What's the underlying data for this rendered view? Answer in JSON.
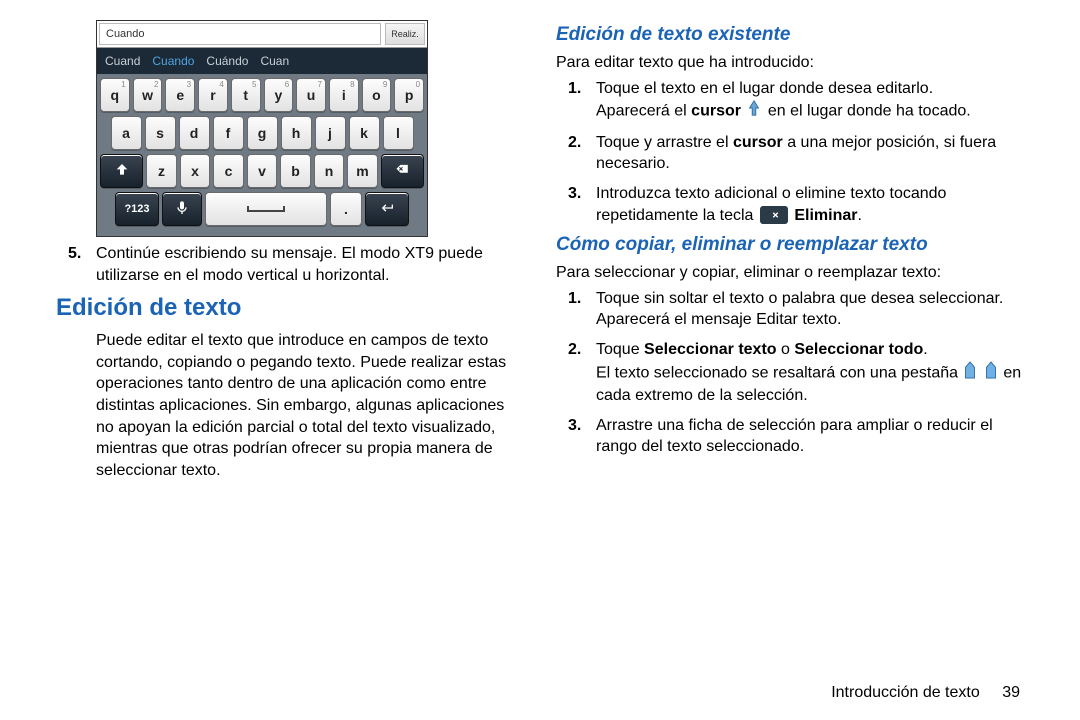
{
  "left": {
    "kb": {
      "input": "Cuando",
      "done": "Realiz.",
      "suggestions": [
        "Cuand",
        "Cuando",
        "Cuándo",
        "Cuan"
      ],
      "row1": [
        [
          "q",
          "1"
        ],
        [
          "w",
          "2"
        ],
        [
          "e",
          "3"
        ],
        [
          "r",
          "4"
        ],
        [
          "t",
          "5"
        ],
        [
          "y",
          "6"
        ],
        [
          "u",
          "7"
        ],
        [
          "i",
          "8"
        ],
        [
          "o",
          "9"
        ],
        [
          "p",
          "0"
        ]
      ],
      "row2": [
        "a",
        "s",
        "d",
        "f",
        "g",
        "h",
        "j",
        "k",
        "l"
      ],
      "row3": [
        "z",
        "x",
        "c",
        "v",
        "b",
        "n",
        "m"
      ],
      "k123": "?123",
      "dot": "."
    },
    "step5": "Continúe escribiendo su mensaje. El modo XT9 puede utilizarse en el modo vertical u horizontal.",
    "h1": "Edición de texto",
    "p1": "Puede editar el texto que introduce en campos de texto cortando, copiando o pegando texto. Puede realizar estas operaciones tanto dentro de una aplicación como entre distintas aplicaciones. Sin embargo, algunas aplicaciones no apoyan la edición parcial o total del texto visualizado, mientras que otras podrían ofrecer su propia manera de seleccionar texto."
  },
  "right": {
    "h2a": "Edición de texto existente",
    "p_intro_a": "Para editar texto que ha introducido:",
    "a1_l1": "Toque el texto en el lugar donde desea editarlo.",
    "a1_l2a": "Aparecerá el ",
    "a1_cursor": "cursor",
    "a1_l2b": " en el lugar donde ha tocado.",
    "a2_a": "Toque y arrastre el ",
    "a2_cursor": "cursor",
    "a2_b": " a una mejor posición, si fuera necesario.",
    "a3_a": "Introduzca texto adicional o elimine texto tocando repetidamente la tecla ",
    "a3_del": "Eliminar",
    "a3_c": ".",
    "h2b": "Cómo copiar, eliminar o reemplazar texto",
    "p_intro_b": "Para seleccionar y copiar, eliminar o reemplazar texto:",
    "b1_l1": "Toque sin soltar el texto o palabra que desea seleccionar.",
    "b1_l2": "Aparecerá el mensaje Editar texto.",
    "b2_a": "Toque ",
    "b2_b1": "Seleccionar texto",
    "b2_o": " o ",
    "b2_b2": "Seleccionar todo",
    "b2_c": ".",
    "b2_l2a": "El texto seleccionado se resaltará con una pestaña ",
    "b2_l2b": " en cada extremo de la selección.",
    "b3": "Arrastre una ficha de selección para ampliar o reducir el rango del texto seleccionado."
  },
  "footer": {
    "section": "Introducción de texto",
    "page": "39"
  }
}
